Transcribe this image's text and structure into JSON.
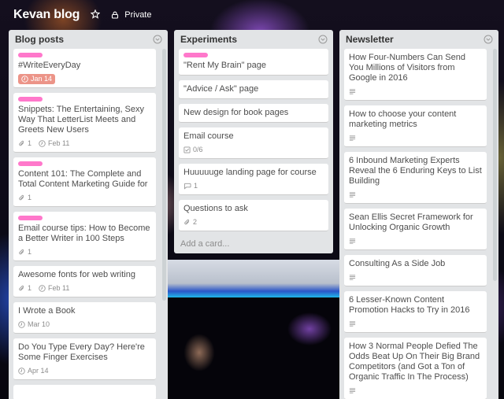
{
  "board": {
    "title": "Kevan blog",
    "star_icon": "star-icon",
    "privacy_label": "Private",
    "privacy_icon": "lock-icon"
  },
  "lists": [
    {
      "title": "Blog posts",
      "menu_icon": "chevron-down-circle-icon",
      "cards": [
        {
          "label_color": "#ff78cb",
          "title": "#WriteEveryDay",
          "due": "Jan 14",
          "due_status": "overdue"
        },
        {
          "label_color": "#ff78cb",
          "title": "Snippets: The Entertaining, Sexy Way That LetterList Meets and Greets New Users",
          "attachments": "1",
          "due": "Feb 11"
        },
        {
          "label_color": "#ff78cb",
          "title": "Content 101: The Complete and Total Content Marketing Guide for",
          "attachments": "1"
        },
        {
          "label_color": "#ff78cb",
          "title": "Email course tips: How to Become a Better Writer in 100 Steps",
          "attachments": "1"
        },
        {
          "title": "Awesome fonts for web writing",
          "attachments": "1",
          "due": "Feb 11"
        },
        {
          "title": "I Wrote a Book",
          "due": "Mar 10"
        },
        {
          "title": "Do You Type Every Day? Here're Some Finger Exercises",
          "due": "Apr 14"
        }
      ]
    },
    {
      "title": "Experiments",
      "menu_icon": "chevron-down-circle-icon",
      "cards": [
        {
          "label_color": "#ff78cb",
          "title": "\"Rent My Brain\" page"
        },
        {
          "title": "\"Advice / Ask\" page"
        },
        {
          "title": "New design for book pages"
        },
        {
          "title": "Email course",
          "checklist": "0/6"
        },
        {
          "title": "Huuuuuge landing page for course",
          "comments": "1"
        },
        {
          "title": "Questions to ask",
          "attachments": "2"
        }
      ],
      "add_card_label": "Add a card..."
    },
    {
      "title": "Newsletter",
      "menu_icon": "chevron-down-circle-icon",
      "cards": [
        {
          "title": "How Four-Numbers Can Send You Millions of Visitors from Google in 2016",
          "has_description": true
        },
        {
          "title": "How to choose your content marketing metrics",
          "has_description": true
        },
        {
          "title": "6 Inbound Marketing Experts Reveal the 6 Enduring Keys to List Building",
          "has_description": true
        },
        {
          "title": "Sean Ellis Secret Framework for Unlocking Organic Growth",
          "has_description": true
        },
        {
          "title": "Consulting As a Side Job",
          "has_description": true
        },
        {
          "title": "6 Lesser-Known Content Promotion Hacks to Try in 2016",
          "has_description": true
        },
        {
          "title": "How 3 Normal People Defied The Odds Beat Up On Their Big Brand Competitors (and Got a Ton of Organic Traffic In The Process)",
          "has_description": true
        }
      ]
    }
  ],
  "colors": {
    "label_pink": "#ff78cb",
    "due_overdue": "#ec9488",
    "list_bg": "#e2e4e6"
  }
}
